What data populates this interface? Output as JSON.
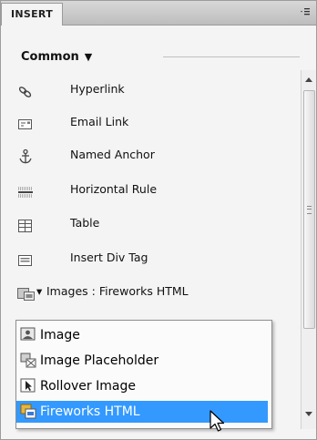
{
  "panel": {
    "tab_label": "INSERT",
    "menu_icon": "panel-menu-icon"
  },
  "category": {
    "label": "Common",
    "arrow": "▼"
  },
  "items": [
    {
      "label": "Hyperlink",
      "icon": "hyperlink-icon"
    },
    {
      "label": "Email Link",
      "icon": "email-link-icon"
    },
    {
      "label": "Named Anchor",
      "icon": "named-anchor-icon"
    },
    {
      "label": "Horizontal Rule",
      "icon": "horizontal-rule-icon"
    },
    {
      "label": "Table",
      "icon": "table-icon"
    },
    {
      "label": "Insert Div Tag",
      "icon": "div-tag-icon"
    },
    {
      "label": "Images : Fireworks HTML",
      "icon": "fireworks-html-icon",
      "arrow": "▾"
    }
  ],
  "dropdown": {
    "options": [
      {
        "label": "Image",
        "icon": "image-icon"
      },
      {
        "label": "Image Placeholder",
        "icon": "image-placeholder-icon"
      },
      {
        "label": "Rollover Image",
        "icon": "rollover-image-icon"
      },
      {
        "label": "Fireworks HTML",
        "icon": "fireworks-html-icon",
        "selected": true
      }
    ],
    "selected_color": "#3399ff"
  }
}
